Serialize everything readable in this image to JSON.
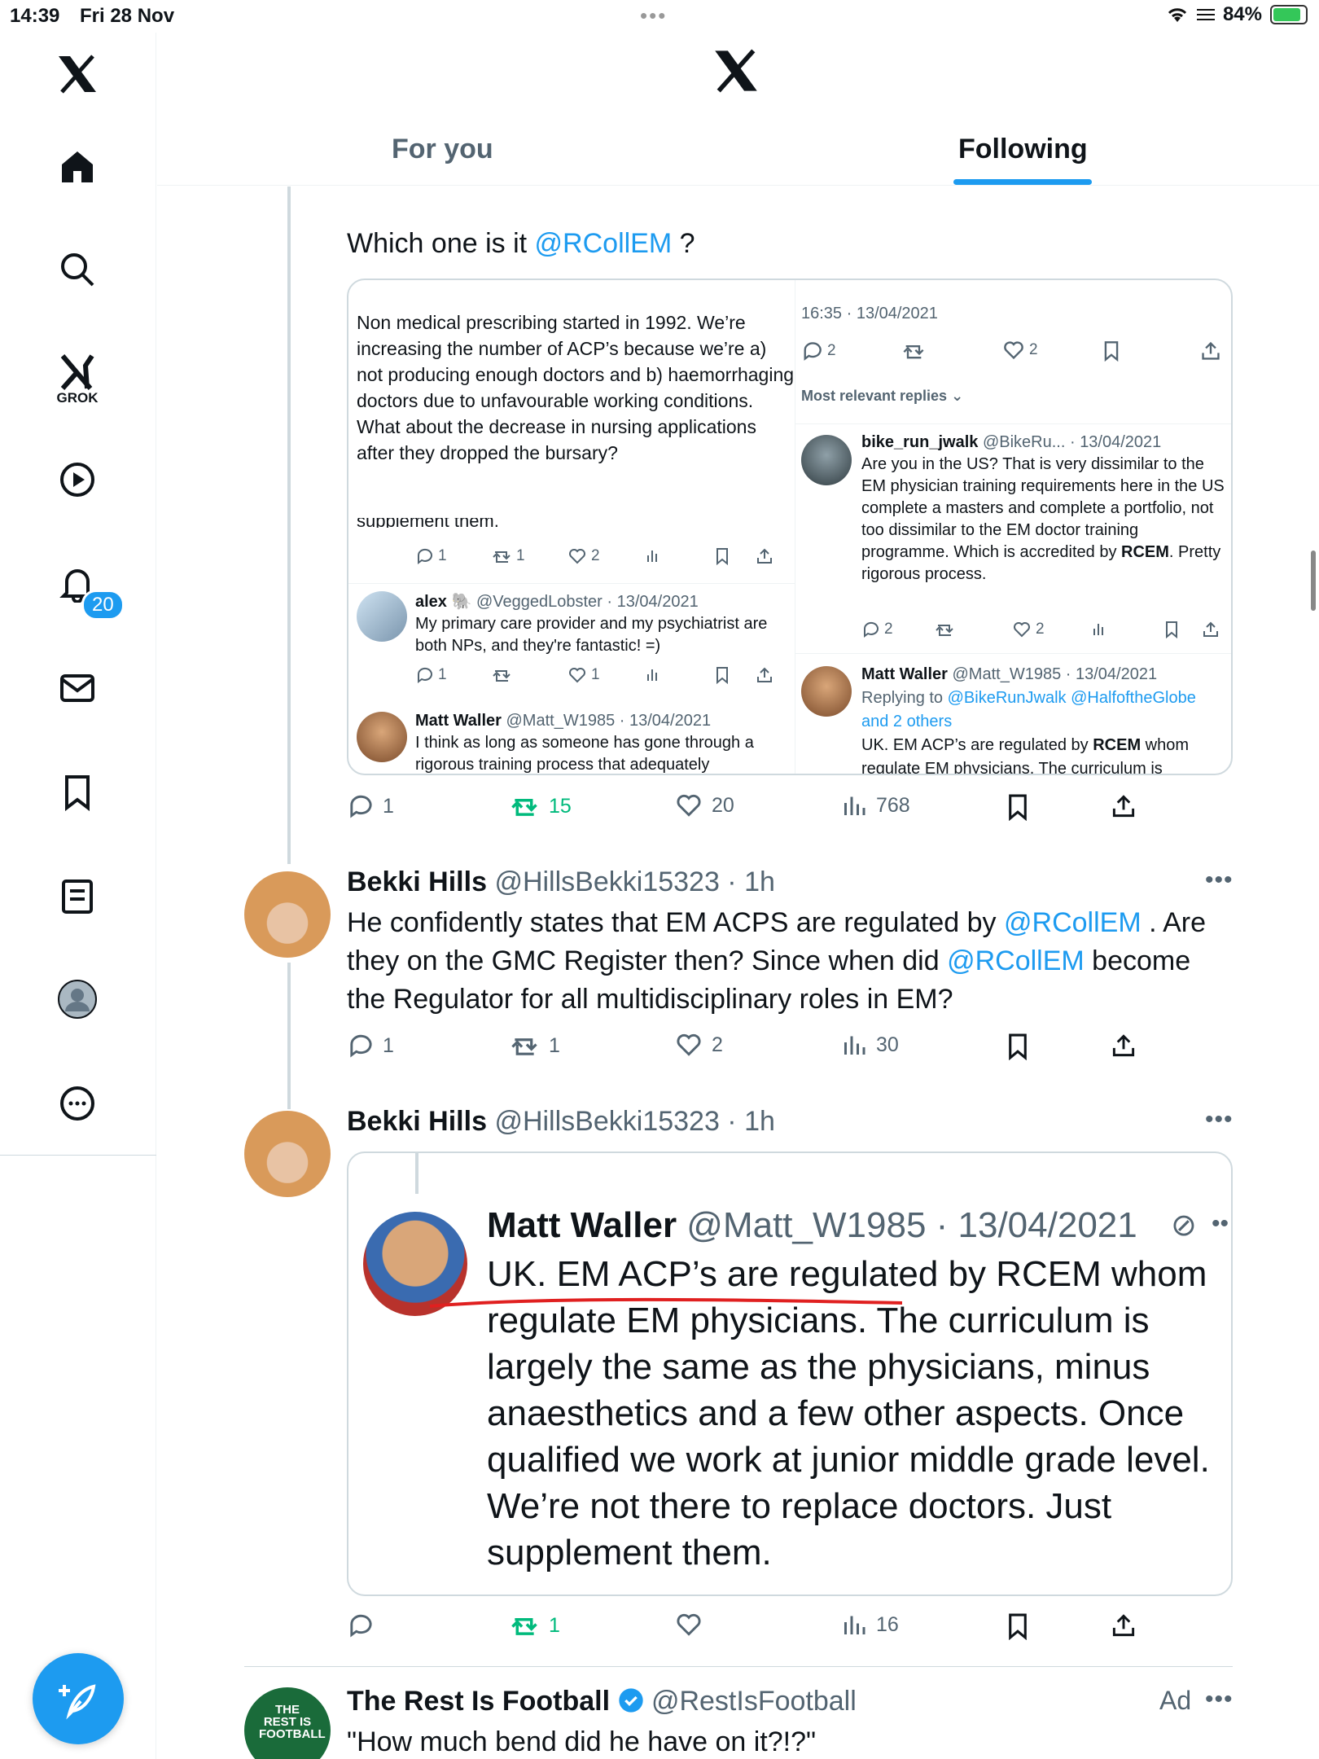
{
  "status_bar": {
    "time": "14:39",
    "date": "Fri 28 Nov",
    "battery": "84%"
  },
  "sidebar": {
    "notifications_badge": "20",
    "grok_label": "GROK"
  },
  "tabs": {
    "for_you": "For you",
    "following": "Following"
  },
  "tweet1": {
    "text_prefix": "Which one is it ",
    "mention": "@RCollEM",
    "text_suffix": " ?",
    "embed": {
      "left_text": "Non medical prescribing started in 1992. We’re increasing the number of ACP’s because we’re a) not producing enough doctors and b) haemorrhaging doctors due to unfavourable working conditions. What about the decrease in nursing applications after they dropped the bursary?",
      "cut_text": "supplement them.",
      "left_row1": {
        "replies": "1",
        "reposts": "1",
        "likes": "2"
      },
      "alex": {
        "name": "alex 🐘",
        "handle": "@VeggedLobster · 13/04/2021",
        "text": "My primary care provider and my psychiatrist are both NPs, and they're fantastic! =)",
        "replies": "1",
        "likes": "1"
      },
      "matt_left": {
        "name": "Matt Waller",
        "handle": "@Matt_W1985 · 13/04/2021",
        "text": "I think as long as someone has gone through a rigorous training process that adequately"
      },
      "right_time": "16:35 · 13/04/2021",
      "right_counts": {
        "replies": "2",
        "likes": "2"
      },
      "most_relevant": "Most relevant replies",
      "bike": {
        "name": "bike_run_jwalk",
        "handle": "@BikeRu... · 13/04/2021",
        "text1": "Are you in the US? That is very dissimilar to the EM physician training requirements here in the US",
        "text2": "complete a masters and complete a portfolio, not too dissimilar to the EM doctor training programme. Which is accredited by",
        "bold": "RCEM",
        "text3": ". Pretty rigorous process.",
        "replies": "2",
        "likes": "2"
      },
      "matt_right": {
        "name": "Matt Waller",
        "handle": "@Matt_W1985 · 13/04/2021",
        "replying": "Replying to",
        "reply_mentions": "@BikeRunJwalk @HalfoftheGlobe",
        "others": "and 2 others",
        "text1": "UK. EM ACP’s are regulated by",
        "bold": "RCEM",
        "text2": " whom",
        "text3": "regulate EM physicians. The curriculum is"
      }
    },
    "actions": {
      "replies": "1",
      "reposts": "15",
      "likes": "20",
      "views": "768"
    }
  },
  "tweet2": {
    "name": "Bekki Hills",
    "handle": "@HillsBekki15323 · 1h",
    "t1": "He confidently states that EM ACPS are regulated by ",
    "m1": "@RCollEM",
    "t2": " . Are they on the GMC Register then? Since when did ",
    "m2": "@RCollEM",
    "t3": " become the Regulator for all multidisciplinary roles in EM?",
    "actions": {
      "replies": "1",
      "reposts": "1",
      "likes": "2",
      "views": "30"
    }
  },
  "tweet3": {
    "name": "Bekki Hills",
    "handle": "@HillsBekki15323 · 1h",
    "embed": {
      "name": "Matt Waller",
      "handle": "@Matt_W1985 · 13/04/2021",
      "text": "UK. EM ACP’s are regulated by RCEM whom regulate EM physicians. The curriculum is largely the same as the physicians, minus anaesthetics and a few other aspects. Once qualified we work at junior middle grade level. We’re not there to replace doctors. Just supplement them."
    },
    "actions": {
      "reposts": "1",
      "views": "16"
    }
  },
  "tweet4": {
    "name": "The Rest Is Football",
    "handle": "@RestIsFootball",
    "ad": "Ad",
    "text": "\"How much bend did he have on it?!?\"",
    "logo_text": "THE REST IS FOOTBALL"
  },
  "colors": {
    "accent": "#1d9bf0",
    "repost_active": "#00ba7c",
    "text": "#0f1419",
    "muted": "#536471"
  }
}
